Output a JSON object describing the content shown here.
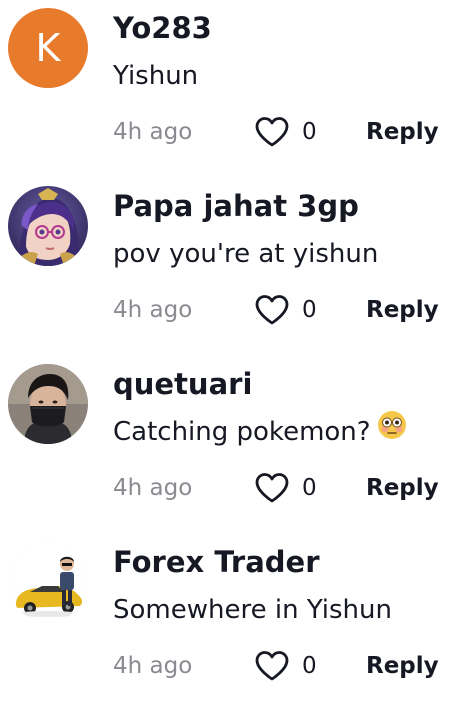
{
  "comments": [
    {
      "avatar": {
        "type": "letter",
        "letter": "K",
        "color": "#e87a2c"
      },
      "username": "Yo283",
      "text": "Yishun",
      "time": "4h ago",
      "likes": "0",
      "reply_label": "Reply"
    },
    {
      "avatar": {
        "type": "image",
        "description_icon": "anime-character-avatar-icon"
      },
      "username": "Papa jahat 3gp",
      "text": "pov you're at yishun",
      "time": "4h ago",
      "likes": "0",
      "reply_label": "Reply"
    },
    {
      "avatar": {
        "type": "image",
        "description_icon": "person-mask-avatar-icon"
      },
      "username": "quetuari",
      "text": "Catching pokemon?",
      "emoji": "flushed-face-emoji",
      "time": "4h ago",
      "likes": "0",
      "reply_label": "Reply"
    },
    {
      "avatar": {
        "type": "image",
        "description_icon": "person-car-avatar-icon"
      },
      "username": "Forex Trader",
      "text": "Somewhere in Yishun",
      "time": "4h ago",
      "likes": "0",
      "reply_label": "Reply"
    }
  ],
  "icons": {
    "like": "heart-outline-icon"
  }
}
